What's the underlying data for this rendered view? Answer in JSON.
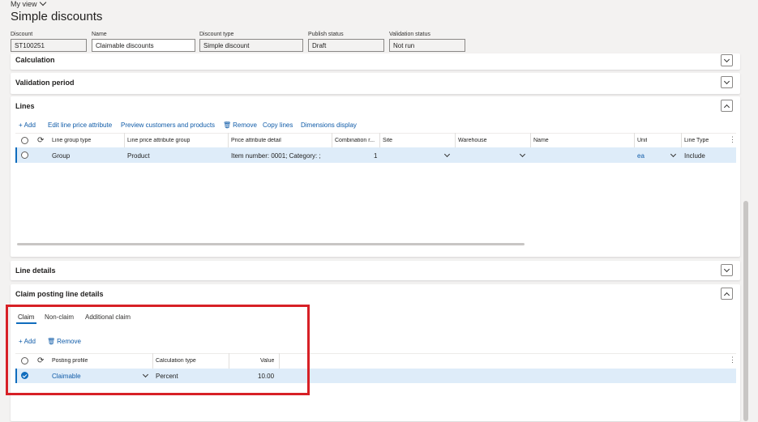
{
  "header": {
    "my_view": "My view",
    "title": "Simple discounts"
  },
  "fields": [
    {
      "label": "Discount",
      "value": "ST100251"
    },
    {
      "label": "Name",
      "value": "Claimable discounts"
    },
    {
      "label": "Discount type",
      "value": "Simple discount"
    },
    {
      "label": "Publish status",
      "value": "Draft"
    },
    {
      "label": "Validation status",
      "value": "Not run"
    }
  ],
  "sections": {
    "calculation": "Calculation",
    "validation_period": "Validation period",
    "lines": "Lines",
    "line_details": "Line details",
    "claim_posting": "Claim posting line details"
  },
  "lines_toolbar": {
    "add": "Add",
    "edit": "Edit line price attribute",
    "preview": "Preview customers and products",
    "remove": "Remove",
    "copy": "Copy lines",
    "dimensions": "Dimensions display"
  },
  "lines_grid": {
    "headers": [
      "Line group type",
      "Line price attribute group",
      "Price attribute detail",
      "Combination r...",
      "Site",
      "Warehouse",
      "Name",
      "Unit",
      "Line Type"
    ],
    "row": {
      "line_group_type": "Group",
      "attribute_group": "Product",
      "attribute_detail": "Item number: 0001; Category: ;",
      "combination": "1",
      "site": "",
      "warehouse": "",
      "name": "",
      "unit": "ea",
      "line_type": "Include"
    }
  },
  "claim_tabs": [
    "Claim",
    "Non-claim",
    "Additional claim"
  ],
  "claim_toolbar": {
    "add": "Add",
    "remove": "Remove"
  },
  "claim_grid": {
    "headers": [
      "Posting profile",
      "Calculation type",
      "Value"
    ],
    "row": {
      "posting_profile": "Claimable",
      "calculation_type": "Percent",
      "value": "10.00"
    }
  }
}
